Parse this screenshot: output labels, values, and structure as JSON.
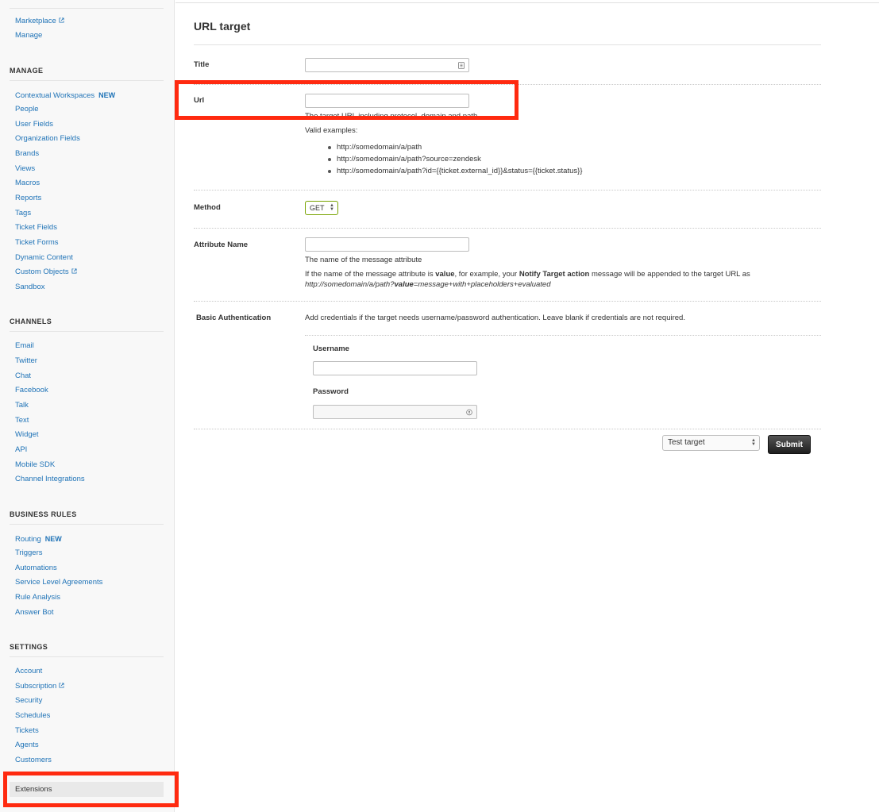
{
  "sidebar": {
    "apps": [
      {
        "label": "Marketplace",
        "external": true
      },
      {
        "label": "Manage",
        "external": false
      }
    ],
    "sections": {
      "manage": {
        "heading": "MANAGE",
        "items": [
          {
            "label": "Contextual Workspaces",
            "badge": "NEW"
          },
          {
            "label": "People"
          },
          {
            "label": "User Fields"
          },
          {
            "label": "Organization Fields"
          },
          {
            "label": "Brands"
          },
          {
            "label": "Views"
          },
          {
            "label": "Macros"
          },
          {
            "label": "Reports"
          },
          {
            "label": "Tags"
          },
          {
            "label": "Ticket Fields"
          },
          {
            "label": "Ticket Forms"
          },
          {
            "label": "Dynamic Content"
          },
          {
            "label": "Custom Objects",
            "external": true
          },
          {
            "label": "Sandbox"
          }
        ]
      },
      "channels": {
        "heading": "CHANNELS",
        "items": [
          {
            "label": "Email"
          },
          {
            "label": "Twitter"
          },
          {
            "label": "Chat"
          },
          {
            "label": "Facebook"
          },
          {
            "label": "Talk"
          },
          {
            "label": "Text"
          },
          {
            "label": "Widget"
          },
          {
            "label": "API"
          },
          {
            "label": "Mobile SDK"
          },
          {
            "label": "Channel Integrations"
          }
        ]
      },
      "business_rules": {
        "heading": "BUSINESS RULES",
        "items": [
          {
            "label": "Routing",
            "badge": "NEW"
          },
          {
            "label": "Triggers"
          },
          {
            "label": "Automations"
          },
          {
            "label": "Service Level Agreements"
          },
          {
            "label": "Rule Analysis"
          },
          {
            "label": "Answer Bot"
          }
        ]
      },
      "settings": {
        "heading": "SETTINGS",
        "items": [
          {
            "label": "Account"
          },
          {
            "label": "Subscription",
            "external": true
          },
          {
            "label": "Security"
          },
          {
            "label": "Schedules"
          },
          {
            "label": "Tickets"
          },
          {
            "label": "Agents"
          },
          {
            "label": "Customers"
          }
        ],
        "active_item": "Extensions"
      }
    }
  },
  "form": {
    "title": "URL target",
    "title_label": "Title",
    "title_value": "",
    "url_label": "Url",
    "url_value": "",
    "url_help": "The target URL including protocol, domain and path.",
    "valid_examples_label": "Valid examples:",
    "examples": [
      "http://somedomain/a/path",
      "http://somedomain/a/path?source=zendesk",
      "http://somedomain/a/path?id={{ticket.external_id}}&status={{ticket.status}}"
    ],
    "method_label": "Method",
    "method_value": "GET",
    "attribute_label": "Attribute Name",
    "attribute_value": "",
    "attribute_help": "The name of the message attribute",
    "attribute_desc": {
      "p1": "If the name of the message attribute is ",
      "b1": "value",
      "p2": ", for example, your ",
      "b2": "Notify Target action",
      "p3": " message will be appended to the target URL as",
      "url_prefix": "http://somedomain/a/path?",
      "url_key": "value",
      "url_suffix": "=message+with+placeholders+evaluated"
    },
    "basic_auth_label": "Basic Authentication",
    "basic_auth_help": "Add credentials if the target needs username/password authentication. Leave blank if credentials are not required.",
    "username_label": "Username",
    "username_value": "",
    "password_label": "Password",
    "password_value": "",
    "test_target_label": "Test target",
    "submit_label": "Submit"
  },
  "colors": {
    "link": "#1f73b7",
    "highlight": "#ff2a10",
    "method_border": "#78a300"
  }
}
